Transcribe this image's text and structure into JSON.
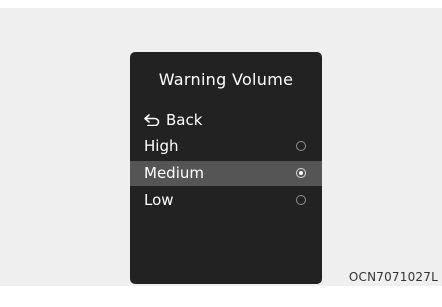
{
  "screen": {
    "title": "Warning Volume",
    "back_label": "Back",
    "options": [
      {
        "label": "High",
        "selected": false
      },
      {
        "label": "Medium",
        "selected": true
      },
      {
        "label": "Low",
        "selected": false
      }
    ]
  },
  "figure_code": "OCN7071027L",
  "icons": {
    "back": "back-arrow-icon",
    "radio": "radio-button-icon"
  },
  "colors": {
    "screen_bg": "#222222",
    "highlight_row": "#555555",
    "figure_bg": "#efefef",
    "text": "#ffffff"
  }
}
